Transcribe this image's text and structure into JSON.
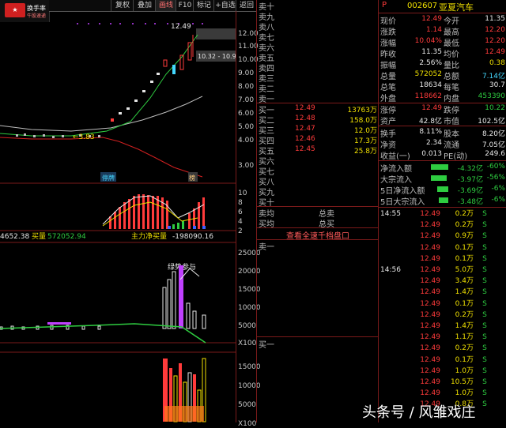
{
  "logo": {
    "title": "换手率",
    "subtitle": "牛股速递"
  },
  "toolbar": {
    "items": [
      "复权",
      "叠加",
      "画线",
      "F10",
      "标记",
      "+自选",
      "返回"
    ]
  },
  "chart": {
    "price_ticks": [
      "12.00",
      "11.00",
      "10.00",
      "9.00",
      "8.00",
      "7.00",
      "6.00",
      "5.00",
      "4.00",
      "3.00"
    ],
    "price_labels": {
      "high": "12.49",
      "low_label": "3.83",
      "range": "10.32 - 10.9"
    },
    "markers": {
      "stop": "停牌",
      "tag": "榜"
    },
    "macd_ticks": [
      "10",
      "8",
      "6",
      "4",
      "2"
    ],
    "net_header": {
      "left": "4652.38",
      "label": "买量",
      "value": "572052.94",
      "mid_label": "主力净买量",
      "mid_value": "-198090.16"
    },
    "vol_ticks": [
      "25000",
      "20000",
      "15000",
      "10000",
      "5000",
      "X100"
    ],
    "vol_label": "绿势参与",
    "vol2_ticks": [
      "15000",
      "10000",
      "5000",
      "X100"
    ]
  },
  "orderbook": {
    "sell_labels": [
      "卖十",
      "卖九",
      "卖八",
      "卖七",
      "卖六",
      "卖五",
      "卖四",
      "卖三",
      "卖二",
      "卖一"
    ],
    "buy": [
      {
        "label": "买一",
        "price": "12.49",
        "vol": "13763万"
      },
      {
        "label": "买二",
        "price": "12.48",
        "vol": "158.0万"
      },
      {
        "label": "买三",
        "price": "12.47",
        "vol": "12.0万"
      },
      {
        "label": "买四",
        "price": "12.46",
        "vol": "17.3万"
      },
      {
        "label": "买五",
        "price": "12.45",
        "vol": "25.8万"
      },
      {
        "label": "买六",
        "price": "",
        "vol": ""
      },
      {
        "label": "买七",
        "price": "",
        "vol": ""
      },
      {
        "label": "买八",
        "price": "",
        "vol": ""
      },
      {
        "label": "买九",
        "price": "",
        "vol": ""
      },
      {
        "label": "买十",
        "price": "",
        "vol": ""
      }
    ],
    "sell_avg": "卖均",
    "sell_total": "总卖",
    "buy_avg": "买均",
    "buy_total": "总买",
    "full_depth": "查看全速千档盘口",
    "sell1_bottom": "卖一",
    "buy1_bottom": "买一"
  },
  "quote": {
    "code": "002607",
    "name": "亚夏汽车",
    "flag": "P",
    "rows": [
      {
        "l1": "现价",
        "v1": "12.49",
        "c1": "red",
        "l2": "今开",
        "v2": "11.35",
        "c2": "white"
      },
      {
        "l1": "涨跌",
        "v1": "1.14",
        "c1": "red",
        "l2": "最高",
        "v2": "12.20",
        "c2": "red"
      },
      {
        "l1": "涨幅",
        "v1": "10.04%",
        "c1": "red",
        "l2": "最低",
        "v2": "12.20",
        "c2": "red"
      },
      {
        "l1": "昨收",
        "v1": "11.35",
        "c1": "white",
        "l2": "均价",
        "v2": "12.49",
        "c2": "red"
      },
      {
        "l1": "振幅",
        "v1": "2.56%",
        "c1": "white",
        "l2": "量比",
        "v2": "0.38",
        "c2": "yellow"
      },
      {
        "l1": "总量",
        "v1": "572052",
        "c1": "yellow",
        "l2": "总额",
        "v2": "7.14亿",
        "c2": "cyan"
      },
      {
        "l1": "总笔",
        "v1": "18634",
        "c1": "white",
        "l2": "每笔",
        "v2": "30.7",
        "c2": "white"
      },
      {
        "l1": "外盘",
        "v1": "118662",
        "c1": "red",
        "l2": "内盘",
        "v2": "453390",
        "c2": "green"
      },
      {
        "l1": "涨停",
        "v1": "12.49",
        "c1": "red",
        "l2": "跌停",
        "v2": "10.22",
        "c2": "green"
      },
      {
        "l1": "资产",
        "v1": "42.8亿",
        "c1": "white",
        "l2": "市值",
        "v2": "102.5亿",
        "c2": "white"
      },
      {
        "l1": "换手",
        "v1": "8.11%",
        "c1": "white",
        "l2": "股本",
        "v2": "8.20亿",
        "c2": "white"
      },
      {
        "l1": "净资",
        "v1": "2.34",
        "c1": "white",
        "l2": "流通",
        "v2": "7.05亿",
        "c2": "white"
      },
      {
        "l1": "收益(一)",
        "v1": "0.013",
        "c1": "white",
        "l2": "PE(动)",
        "v2": "249.6",
        "c2": "white"
      }
    ],
    "flows": [
      {
        "label": "净流入额",
        "value": "-4.32亿",
        "pct": "-60%"
      },
      {
        "label": "大宗流入",
        "value": "-3.97亿",
        "pct": "-56%"
      },
      {
        "label": "5日净流入额",
        "value": "-3.69亿",
        "pct": "-6%"
      },
      {
        "label": "5日大宗流入",
        "value": "-3.48亿",
        "pct": "-6%"
      }
    ],
    "ticks": [
      {
        "time": "14:55",
        "price": "12.49",
        "vol": "0.2万",
        "side": "S"
      },
      {
        "time": "",
        "price": "12.49",
        "vol": "0.2万",
        "side": "S"
      },
      {
        "time": "",
        "price": "12.49",
        "vol": "0.9万",
        "side": "S"
      },
      {
        "time": "",
        "price": "12.49",
        "vol": "0.1万",
        "side": "S"
      },
      {
        "time": "",
        "price": "12.49",
        "vol": "0.1万",
        "side": "S"
      },
      {
        "time": "14:56",
        "price": "12.49",
        "vol": "5.0万",
        "side": "S"
      },
      {
        "time": "",
        "price": "12.49",
        "vol": "3.4万",
        "side": "S"
      },
      {
        "time": "",
        "price": "12.49",
        "vol": "1.4万",
        "side": "S"
      },
      {
        "time": "",
        "price": "12.49",
        "vol": "0.1万",
        "side": "S"
      },
      {
        "time": "",
        "price": "12.49",
        "vol": "0.2万",
        "side": "S"
      },
      {
        "time": "",
        "price": "12.49",
        "vol": "1.4万",
        "side": "S"
      },
      {
        "time": "",
        "price": "12.49",
        "vol": "1.1万",
        "side": "S"
      },
      {
        "time": "",
        "price": "12.49",
        "vol": "0.2万",
        "side": "S"
      },
      {
        "time": "",
        "price": "12.49",
        "vol": "0.1万",
        "side": "S"
      },
      {
        "time": "",
        "price": "12.49",
        "vol": "1.0万",
        "side": "S"
      },
      {
        "time": "",
        "price": "12.49",
        "vol": "10.5万",
        "side": "S"
      },
      {
        "time": "",
        "price": "12.49",
        "vol": "1.0万",
        "side": "S"
      },
      {
        "time": "",
        "price": "12.49",
        "vol": "0.8万",
        "side": "S"
      }
    ]
  },
  "watermark": "头条号 / 风雏戏庄",
  "colors": {
    "up": "#ff3b3b",
    "down": "#2ecc40",
    "accent": "#f0e000",
    "divider": "#7a1a1a"
  }
}
